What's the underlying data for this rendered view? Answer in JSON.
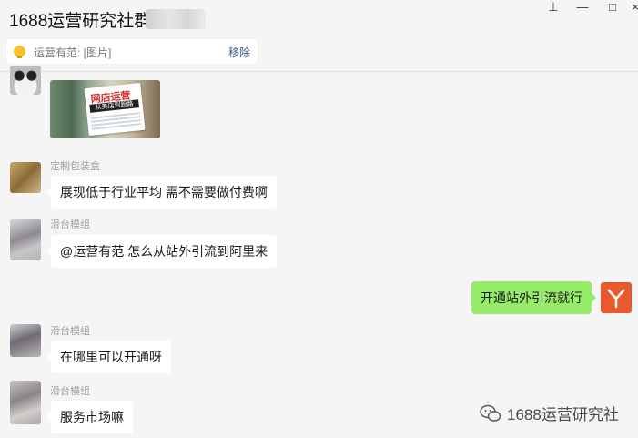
{
  "window": {
    "title": "1688运营研究社群",
    "controls": {
      "pin": "⊥",
      "minimize": "—",
      "maximize": "□",
      "close": "×"
    }
  },
  "pinned": {
    "text": "运营有范: [图片]",
    "remove_label": "移除"
  },
  "image_message": {
    "book_title": "网店运营",
    "book_subtitle": "从美店到跑路"
  },
  "messages": [
    {
      "sender": "定制包装盒",
      "text": "展现低于行业平均 需不需要做付费啊"
    },
    {
      "sender": "滑台模组",
      "text": "@运营有范 怎么从站外引流到阿里来"
    },
    {
      "sender": "",
      "text": "开通站外引流就行",
      "mine": true
    },
    {
      "sender": "滑台模组",
      "text": "在哪里可以开通呀"
    },
    {
      "sender": "滑台模组",
      "text": "服务市场嘛"
    }
  ],
  "watermark": {
    "text": "1688运营研究社"
  },
  "colors": {
    "bubble_mine": "#95ec69",
    "self_avatar": "#e85a2e",
    "link": "#3d5a8c"
  }
}
